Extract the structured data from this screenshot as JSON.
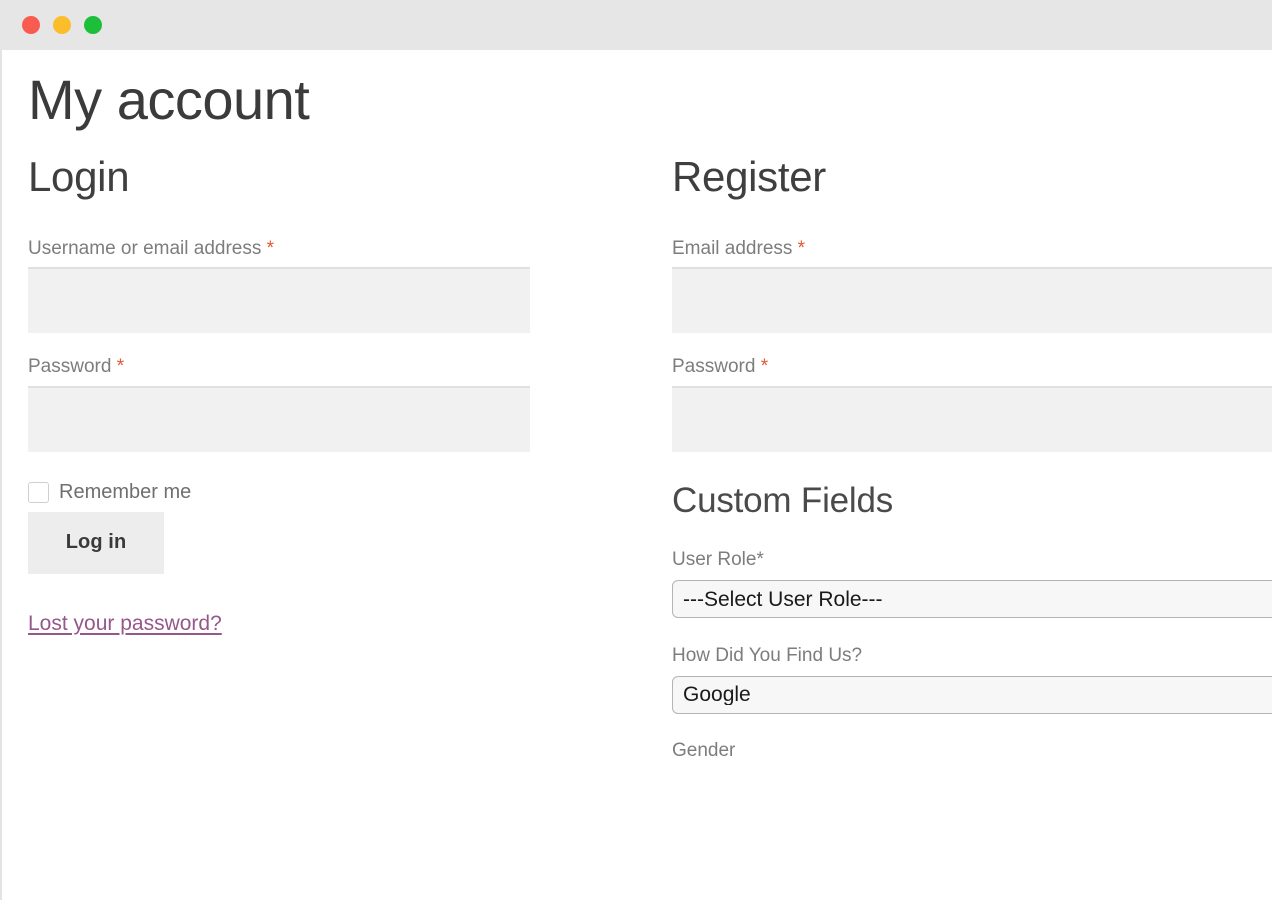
{
  "window": {
    "traffic_lights": [
      {
        "name": "close",
        "color": "#fa5b51"
      },
      {
        "name": "minimize",
        "color": "#fcbd2b"
      },
      {
        "name": "maximize",
        "color": "#1dbf3a"
      }
    ]
  },
  "page": {
    "title": "My account"
  },
  "login": {
    "heading": "Login",
    "username": {
      "label": "Username or email address",
      "required_mark": "*",
      "value": "",
      "placeholder": ""
    },
    "password": {
      "label": "Password",
      "required_mark": "*",
      "value": "",
      "placeholder": ""
    },
    "remember_me_label": "Remember me",
    "remember_me_checked": false,
    "submit_label": "Log in",
    "lost_password_label": "Lost your password?",
    "lost_password_color": "#96588a"
  },
  "register": {
    "heading": "Register",
    "email": {
      "label": "Email address",
      "required_mark": "*",
      "value": "",
      "placeholder": ""
    },
    "password": {
      "label": "Password",
      "required_mark": "*",
      "value": "",
      "placeholder": ""
    },
    "custom_fields": {
      "heading": "Custom Fields",
      "user_role": {
        "label": "User Role*",
        "selected": "---Select User Role---"
      },
      "how_did_you_find_us": {
        "label": "How Did You Find Us?",
        "selected": "Google"
      },
      "gender": {
        "label": "Gender"
      }
    }
  },
  "colors": {
    "titlebar": "#e6e6e6",
    "required_asterisk": "#e0583a",
    "label_text": "#7d7d7d",
    "input_fill": "#f1f1f1",
    "button_fill": "#ededed",
    "link_purple": "#96588a"
  }
}
